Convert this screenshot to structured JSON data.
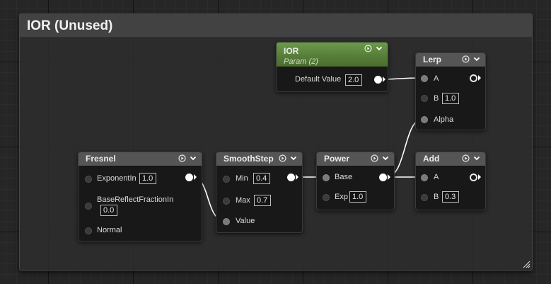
{
  "comment": {
    "title": "IOR (Unused)"
  },
  "colors": {
    "param_header": "#5e8a40",
    "node_header": "#555555",
    "wire": "#ffffff",
    "background": "#262626"
  },
  "icons": {
    "header_left": "play-circle-icon",
    "header_right": "chevron-down-icon"
  },
  "nodes": {
    "ior": {
      "title": "IOR",
      "subtitle": "Param (2)",
      "default_label": "Default Value",
      "default_value": "2.0"
    },
    "lerp": {
      "title": "Lerp",
      "pins": {
        "a": "A",
        "b": "B",
        "alpha": "Alpha"
      },
      "b_value": "1.0"
    },
    "fresnel": {
      "title": "Fresnel",
      "pins": {
        "exponent": "ExponentIn",
        "base_reflect": "BaseReflectFractionIn",
        "normal": "Normal"
      },
      "exponent_value": "1.0",
      "base_reflect_value": "0.0"
    },
    "smoothstep": {
      "title": "SmoothStep",
      "pins": {
        "min": "Min",
        "max": "Max",
        "value": "Value"
      },
      "min_value": "0.4",
      "max_value": "0.7"
    },
    "power": {
      "title": "Power",
      "pins": {
        "base": "Base",
        "exp": "Exp"
      },
      "exp_value": "1.0"
    },
    "add": {
      "title": "Add",
      "pins": {
        "a": "A",
        "b": "B"
      },
      "b_value": "0.3"
    }
  }
}
